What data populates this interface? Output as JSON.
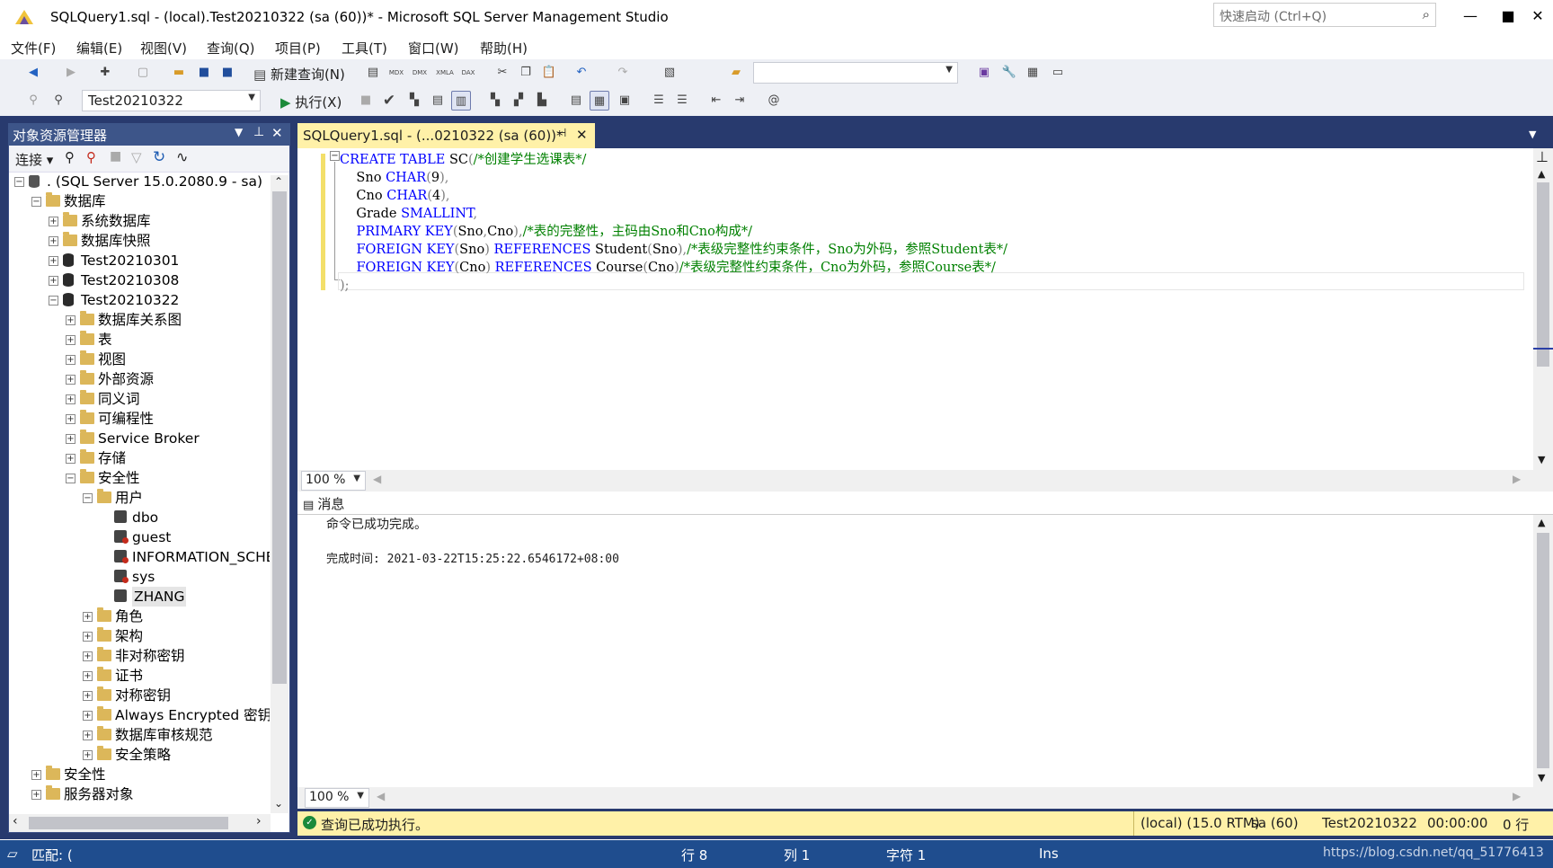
{
  "window": {
    "title": "SQLQuery1.sql - (local).Test20210322 (sa (60))* - Microsoft SQL Server Management Studio",
    "quick_launch_placeholder": "快速启动 (Ctrl+Q)",
    "minimize": "—",
    "maximize": "■",
    "close": "✕"
  },
  "menu": [
    "文件(F)",
    "编辑(E)",
    "视图(V)",
    "查询(Q)",
    "项目(P)",
    "工具(T)",
    "窗口(W)",
    "帮助(H)"
  ],
  "toolbar": {
    "new_query": "新建查询(N)",
    "database_combo": "Test20210322",
    "execute": "执行(X)",
    "mdx": "MDX",
    "dmx": "DMX",
    "xmla": "XMLA",
    "dax": "DAX"
  },
  "object_explorer": {
    "title": "对象资源管理器",
    "connect": "连接",
    "tree": [
      {
        "label": ". (SQL Server 15.0.2080.9 - sa)",
        "level": 0,
        "icon": "server",
        "expanded": true
      },
      {
        "label": "数据库",
        "level": 1,
        "icon": "folder",
        "expanded": true
      },
      {
        "label": "系统数据库",
        "level": 2,
        "icon": "folder",
        "expanded": false
      },
      {
        "label": "数据库快照",
        "level": 2,
        "icon": "folder",
        "expanded": false
      },
      {
        "label": "Test20210301",
        "level": 2,
        "icon": "db",
        "expanded": false
      },
      {
        "label": "Test20210308",
        "level": 2,
        "icon": "db",
        "expanded": false
      },
      {
        "label": "Test20210322",
        "level": 2,
        "icon": "db",
        "expanded": true
      },
      {
        "label": "数据库关系图",
        "level": 3,
        "icon": "folder",
        "expanded": false
      },
      {
        "label": "表",
        "level": 3,
        "icon": "folder",
        "expanded": false
      },
      {
        "label": "视图",
        "level": 3,
        "icon": "folder",
        "expanded": false
      },
      {
        "label": "外部资源",
        "level": 3,
        "icon": "folder",
        "expanded": false
      },
      {
        "label": "同义词",
        "level": 3,
        "icon": "folder",
        "expanded": false
      },
      {
        "label": "可编程性",
        "level": 3,
        "icon": "folder",
        "expanded": false
      },
      {
        "label": "Service Broker",
        "level": 3,
        "icon": "folder",
        "expanded": false
      },
      {
        "label": "存储",
        "level": 3,
        "icon": "folder",
        "expanded": false
      },
      {
        "label": "安全性",
        "level": 3,
        "icon": "folder",
        "expanded": true
      },
      {
        "label": "用户",
        "level": 4,
        "icon": "folder",
        "expanded": true
      },
      {
        "label": "dbo",
        "level": 5,
        "icon": "user",
        "expanded": null
      },
      {
        "label": "guest",
        "level": 5,
        "icon": "user-disabled",
        "expanded": null
      },
      {
        "label": "INFORMATION_SCHE",
        "level": 5,
        "icon": "user-disabled",
        "expanded": null
      },
      {
        "label": "sys",
        "level": 5,
        "icon": "user-disabled",
        "expanded": null
      },
      {
        "label": "ZHANG",
        "level": 5,
        "icon": "user",
        "expanded": null
      },
      {
        "label": "角色",
        "level": 4,
        "icon": "folder",
        "expanded": false
      },
      {
        "label": "架构",
        "level": 4,
        "icon": "folder",
        "expanded": false
      },
      {
        "label": "非对称密钥",
        "level": 4,
        "icon": "folder",
        "expanded": false
      },
      {
        "label": "证书",
        "level": 4,
        "icon": "folder",
        "expanded": false
      },
      {
        "label": "对称密钥",
        "level": 4,
        "icon": "folder",
        "expanded": false
      },
      {
        "label": "Always Encrypted 密钥",
        "level": 4,
        "icon": "folder",
        "expanded": false
      },
      {
        "label": "数据库审核规范",
        "level": 4,
        "icon": "folder",
        "expanded": false
      },
      {
        "label": "安全策略",
        "level": 4,
        "icon": "folder",
        "expanded": false
      },
      {
        "label": "安全性",
        "level": 1,
        "icon": "folder",
        "expanded": false
      },
      {
        "label": "服务器对象",
        "level": 1,
        "icon": "folder",
        "expanded": false
      }
    ]
  },
  "editor": {
    "tab_title": "SQLQuery1.sql - (...0210322 (sa (60))*",
    "zoom": "100 %",
    "lines": [
      [
        {
          "t": "CREATE TABLE",
          "c": "kw"
        },
        {
          "t": " SC",
          "c": ""
        },
        {
          "t": "(",
          "c": "gr"
        },
        {
          "t": "/*创建学生选课表*/",
          "c": "cm"
        }
      ],
      [
        {
          "t": "    Sno ",
          "c": ""
        },
        {
          "t": "CHAR",
          "c": "kw"
        },
        {
          "t": "(",
          "c": "gr"
        },
        {
          "t": "9",
          "c": ""
        },
        {
          "t": "),",
          "c": "gr"
        }
      ],
      [
        {
          "t": "    Cno ",
          "c": ""
        },
        {
          "t": "CHAR",
          "c": "kw"
        },
        {
          "t": "(",
          "c": "gr"
        },
        {
          "t": "4",
          "c": ""
        },
        {
          "t": "),",
          "c": "gr"
        }
      ],
      [
        {
          "t": "    Grade ",
          "c": ""
        },
        {
          "t": "SMALLINT",
          "c": "kw"
        },
        {
          "t": ",",
          "c": "gr"
        }
      ],
      [
        {
          "t": "    ",
          "c": ""
        },
        {
          "t": "PRIMARY KEY",
          "c": "kw"
        },
        {
          "t": "(",
          "c": "gr"
        },
        {
          "t": "Sno",
          "c": ""
        },
        {
          "t": ",",
          "c": "gr"
        },
        {
          "t": "Cno",
          "c": ""
        },
        {
          "t": "),",
          "c": "gr"
        },
        {
          "t": "/*表的完整性，主码由Sno和Cno构成*/",
          "c": "cm"
        }
      ],
      [
        {
          "t": "    ",
          "c": ""
        },
        {
          "t": "FOREIGN KEY",
          "c": "kw"
        },
        {
          "t": "(",
          "c": "gr"
        },
        {
          "t": "Sno",
          "c": ""
        },
        {
          "t": ") ",
          "c": "gr"
        },
        {
          "t": "REFERENCES",
          "c": "kw"
        },
        {
          "t": " Student",
          "c": ""
        },
        {
          "t": "(",
          "c": "gr"
        },
        {
          "t": "Sno",
          "c": ""
        },
        {
          "t": "),",
          "c": "gr"
        },
        {
          "t": "/*表级完整性约束条件，Sno为外码，参照Student表*/",
          "c": "cm"
        }
      ],
      [
        {
          "t": "    ",
          "c": ""
        },
        {
          "t": "FOREIGN KEY",
          "c": "kw"
        },
        {
          "t": "(",
          "c": "gr"
        },
        {
          "t": "Cno",
          "c": ""
        },
        {
          "t": ") ",
          "c": "gr"
        },
        {
          "t": "REFERENCES",
          "c": "kw"
        },
        {
          "t": " Course",
          "c": ""
        },
        {
          "t": "(",
          "c": "gr"
        },
        {
          "t": "Cno",
          "c": ""
        },
        {
          "t": ")",
          "c": "gr"
        },
        {
          "t": "/*表级完整性约束条件，Cno为外码，参照Course表*/",
          "c": "cm"
        }
      ],
      [
        {
          "t": ");",
          "c": "gr"
        }
      ]
    ]
  },
  "messages": {
    "tab": "消息",
    "line1": "命令已成功完成。",
    "line2": "完成时间: 2021-03-22T15:25:22.6546172+08:00",
    "zoom": "100 %"
  },
  "query_status": {
    "message": "查询已成功执行。",
    "server": "(local) (15.0 RTM)",
    "user": "sa (60)",
    "database": "Test20210322",
    "elapsed": "00:00:00",
    "rows": "0 行"
  },
  "statusbar": {
    "left": "匹配: (",
    "line": "行 8",
    "col": "列 1",
    "char": "字符 1",
    "mode": "Ins",
    "watermark": "https://blog.csdn.net/qq_51776413"
  }
}
